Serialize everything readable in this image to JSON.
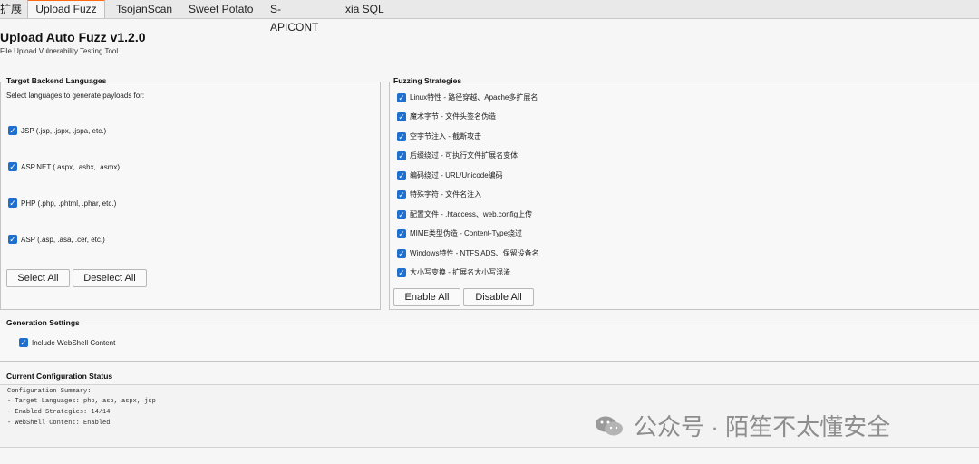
{
  "tabs": [
    {
      "label": "扩展"
    },
    {
      "label": "Upload Fuzz"
    },
    {
      "label": "TsojanScan"
    },
    {
      "label": "Sweet Potato"
    },
    {
      "label": "S-APICONT"
    },
    {
      "label": "xia SQL"
    }
  ],
  "header": {
    "title": "Upload Auto Fuzz v1.2.0",
    "subtitle": "File Upload Vulnerability Testing Tool"
  },
  "languages": {
    "title": "Target Backend Languages",
    "instruction": "Select languages to generate payloads for:",
    "items": [
      {
        "label": "JSP (.jsp, .jspx, .jspa, etc.)"
      },
      {
        "label": "ASP.NET (.aspx, .ashx, .asmx)"
      },
      {
        "label": "PHP (.php, .phtml, .phar, etc.)"
      },
      {
        "label": "ASP (.asp, .asa, .cer, etc.)"
      }
    ],
    "select_all": "Select All",
    "deselect_all": "Deselect All"
  },
  "strategies": {
    "title": "Fuzzing Strategies",
    "items": [
      {
        "label": "Linux特性 - 路径穿越、Apache多扩展名"
      },
      {
        "label": "魔术字节 - 文件头签名伪造"
      },
      {
        "label": "空字节注入 - 截断攻击"
      },
      {
        "label": "后缀绕过 - 可执行文件扩展名变体"
      },
      {
        "label": "编码绕过 - URL/Unicode编码"
      },
      {
        "label": "特殊字符 - 文件名注入"
      },
      {
        "label": "配置文件 - .htaccess、web.config上传"
      },
      {
        "label": "MIME类型伪造 - Content-Type绕过"
      },
      {
        "label": "Windows特性 - NTFS ADS、保留设备名"
      },
      {
        "label": "大小写变换 - 扩展名大小写混淆"
      }
    ],
    "enable_all": "Enable All",
    "disable_all": "Disable All"
  },
  "generation": {
    "title": "Generation Settings",
    "webshell_label": "Include WebShell Content"
  },
  "status": {
    "title": "Current Configuration Status",
    "lines": [
      "Configuration Summary:",
      "  - Target Languages: php, asp, aspx, jsp",
      "  - Enabled Strategies: 14/14",
      "  - WebShell Content: Enabled"
    ]
  },
  "watermark": {
    "text": "公众号 · 陌笙不太懂安全"
  },
  "colors": {
    "accent_tab": "#ff6a13",
    "checkbox": "#1f6fcf"
  }
}
